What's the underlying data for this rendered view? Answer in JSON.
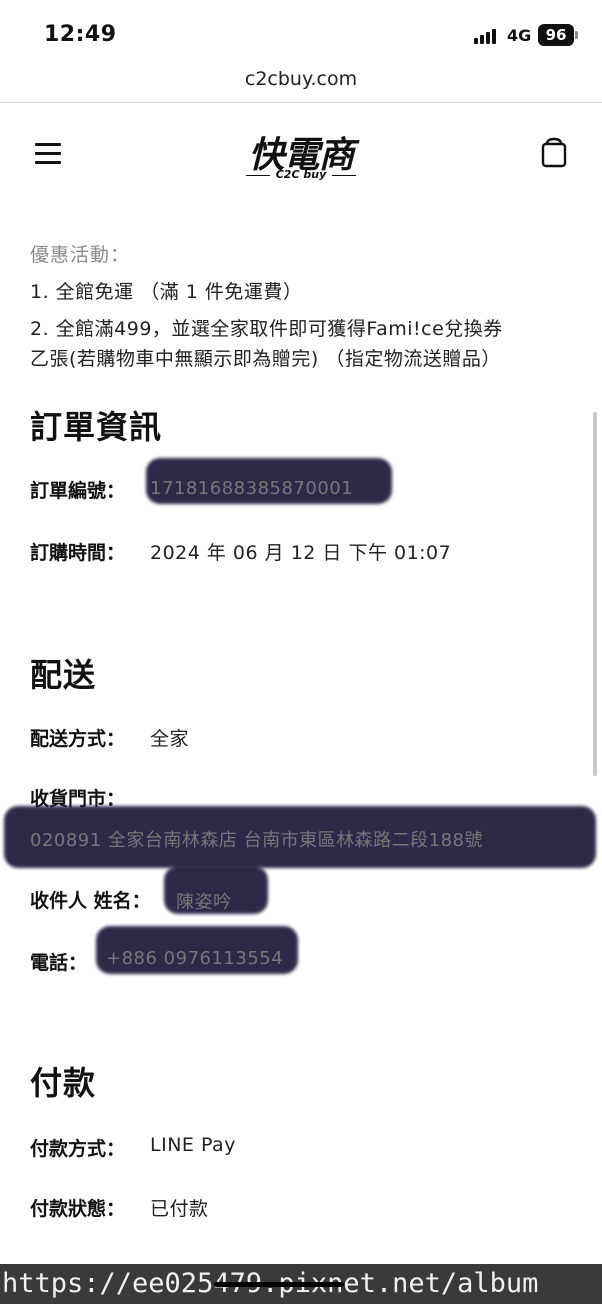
{
  "status_bar": {
    "time": "12:49",
    "network": "4G",
    "battery": "96"
  },
  "browser": {
    "url": "c2cbuy.com"
  },
  "header": {
    "logo_main": "快電商",
    "logo_sub": "C2C buy",
    "menu_icon": "hamburger-menu-icon",
    "cart_icon": "shopping-bag-icon"
  },
  "promo": {
    "title": "優惠活動：",
    "lines": [
      "1. 全館免運 （滿 1 件免運費）",
      "2. 全館滿499，並選全家取件即可獲得Fami!ce兌換券",
      "乙張(若購物車中無顯示即為贈完) （指定物流送贈品）"
    ]
  },
  "order_info": {
    "title": "訂單資訊",
    "number_label": "訂單編號：",
    "number_value": "17181688385870001",
    "time_label": "訂購時間：",
    "time_value": "2024 年 06 月 12 日 下午 01:07"
  },
  "shipping": {
    "title": "配送",
    "method_label": "配送方式：",
    "method_value": "全家",
    "store_label": "收貨門市：",
    "store_value": "020891 全家台南林森店 台南市東區林森路二段188號",
    "name_label": "收件人 姓名：",
    "name_value": "陳姿吟",
    "phone_label": "電話：",
    "phone_value": "+886 0976113554"
  },
  "payment": {
    "title": "付款",
    "method_label": "付款方式：",
    "method_value": "LINE Pay",
    "status_label": "付款狀態：",
    "status_value": "已付款"
  },
  "watermark": {
    "text": "https://ee025479.pixnet.net/album"
  },
  "colors": {
    "background": "#ffffff",
    "text": "#111111",
    "muted": "#8a8a8a",
    "redaction": "#1c1838"
  }
}
